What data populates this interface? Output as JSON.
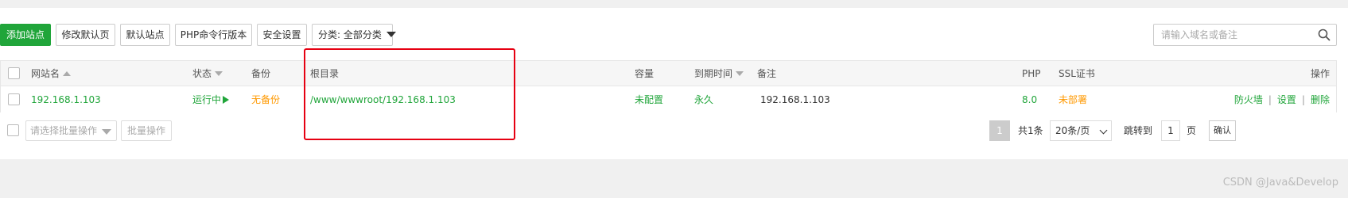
{
  "toolbar": {
    "add_site": "添加站点",
    "modify_default_page": "修改默认页",
    "default_site": "默认站点",
    "php_cli_version": "PHP命令行版本",
    "security_settings": "安全设置",
    "category_filter": "分类: 全部分类"
  },
  "search": {
    "placeholder": "请输入域名或备注"
  },
  "table": {
    "columns": {
      "site_name": "网站名",
      "status": "状态",
      "backup": "备份",
      "root_dir": "根目录",
      "capacity": "容量",
      "expire_time": "到期时间",
      "remark": "备注",
      "php": "PHP",
      "ssl": "SSL证书",
      "actions": "操作"
    },
    "rows": [
      {
        "site_name": "192.168.1.103",
        "status": "运行中",
        "backup": "无备份",
        "root_dir": "/www/wwwroot/192.168.1.103",
        "capacity": "未配置",
        "expire_time": "永久",
        "remark": "192.168.1.103",
        "php": "8.0",
        "ssl": "未部署",
        "action_firewall": "防火墙",
        "action_settings": "设置",
        "action_delete": "删除",
        "separator": "|"
      }
    ]
  },
  "footer": {
    "batch_placeholder": "请选择批量操作",
    "batch_button": "批量操作",
    "current_page": "1",
    "total": "共1条",
    "per_page": "20条/页",
    "jump_to": "跳转到",
    "jump_value": "1",
    "page_unit": "页",
    "confirm": "确认"
  },
  "watermark": "CSDN @Java&Develop",
  "colors": {
    "accent": "#20a53a",
    "warning": "#ff9900",
    "highlight_box": "#e60012"
  }
}
